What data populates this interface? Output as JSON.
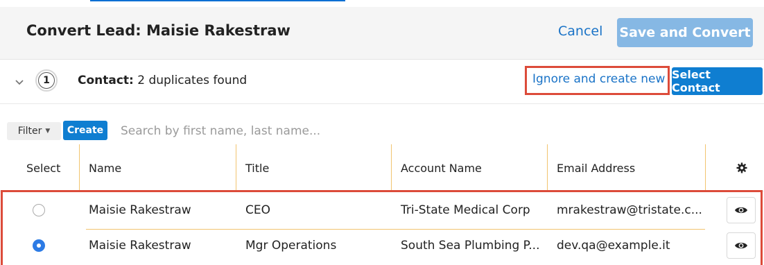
{
  "header": {
    "title": "Convert Lead: Maisie Rakestraw",
    "cancel_label": "Cancel",
    "save_label": "Save and Convert"
  },
  "contact": {
    "step_number": "1",
    "label": "Contact:",
    "duplicates_text": "2 duplicates found",
    "ignore_label": "Ignore and create new",
    "select_label": "Select Contact"
  },
  "filter": {
    "filter_label": "Filter",
    "create_label": "Create",
    "search_placeholder": "Search by first name, last name..."
  },
  "table": {
    "columns": [
      "Select",
      "Name",
      "Title",
      "Account Name",
      "Email Address"
    ],
    "rows": [
      {
        "selected": false,
        "name": "Maisie Rakestraw",
        "title": "CEO",
        "account": "Tri-State Medical Corp",
        "email": "mrakestraw@tristate.c..."
      },
      {
        "selected": true,
        "name": "Maisie Rakestraw",
        "title": "Mgr Operations",
        "account": "South Sea Plumbing P...",
        "email": "dev.qa@example.it"
      }
    ]
  },
  "icons": {
    "chevron": "chevron-down-icon",
    "gear": "gear-icon",
    "eye": "eye-icon"
  },
  "colors": {
    "accent": "#0f7ed1",
    "link": "#1a73c7",
    "save_disabled": "#86b8e4",
    "highlight": "#dc4b3a",
    "column_separator": "#f2c46f"
  }
}
